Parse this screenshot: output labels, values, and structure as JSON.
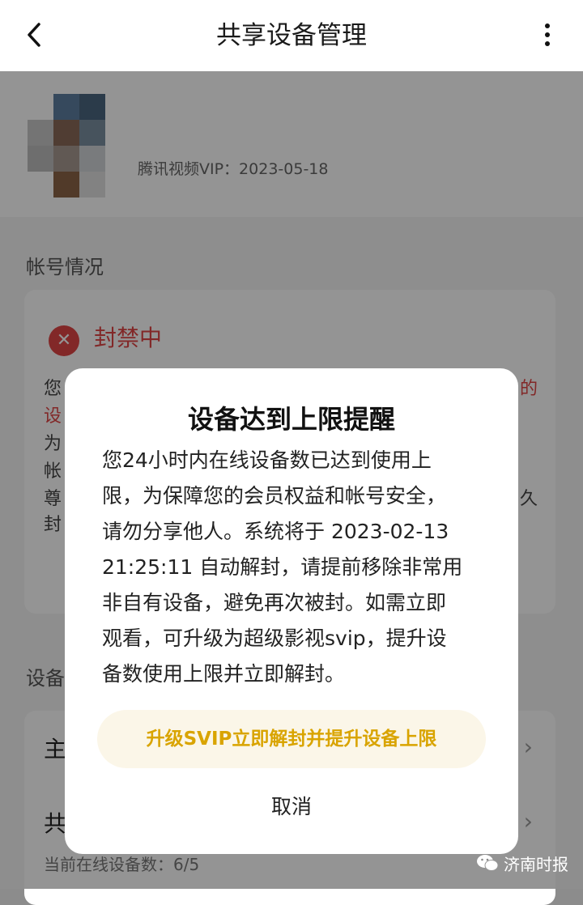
{
  "header": {
    "title": "共享设备管理",
    "back_icon": "back-arrow-icon",
    "more_icon": "more-vertical-icon"
  },
  "profile": {
    "vip_text": "腾讯视频VIP：2023-05-18"
  },
  "account_section": {
    "title": "帐号情况",
    "status_label": "封禁中",
    "status_icon": "close-circle-icon",
    "status_color": "#e04545",
    "visible_fragments": [
      "您",
      "设",
      "为",
      "帐",
      "尊",
      "封",
      "的",
      "久"
    ]
  },
  "device_section": {
    "title_fragment": "设备",
    "row1_fragment": "主",
    "row2_fragment": "共",
    "online_count_text": "当前在线设备数：6/5"
  },
  "dialog": {
    "title": "设备达到上限提醒",
    "body_lines": [
      "您24小时内在线设备数已达到使用上",
      "限，为保障您的会员权益和帐号安全，",
      "请勿分享他人。系统将于 2023-02-13",
      "21:25:11 自动解封，请提前移除非常用",
      "非自有设备，避免再次被封。如需立即",
      "观看，可升级为超级影视svip，提升设",
      "备数使用上限并立即解封。"
    ],
    "upgrade_button": "升级SVIP立即解封并提升设备上限",
    "cancel_button": "取消",
    "accent_color": "#d9a400"
  },
  "watermark": {
    "text": "济南时报",
    "icon": "wechat-icon"
  }
}
